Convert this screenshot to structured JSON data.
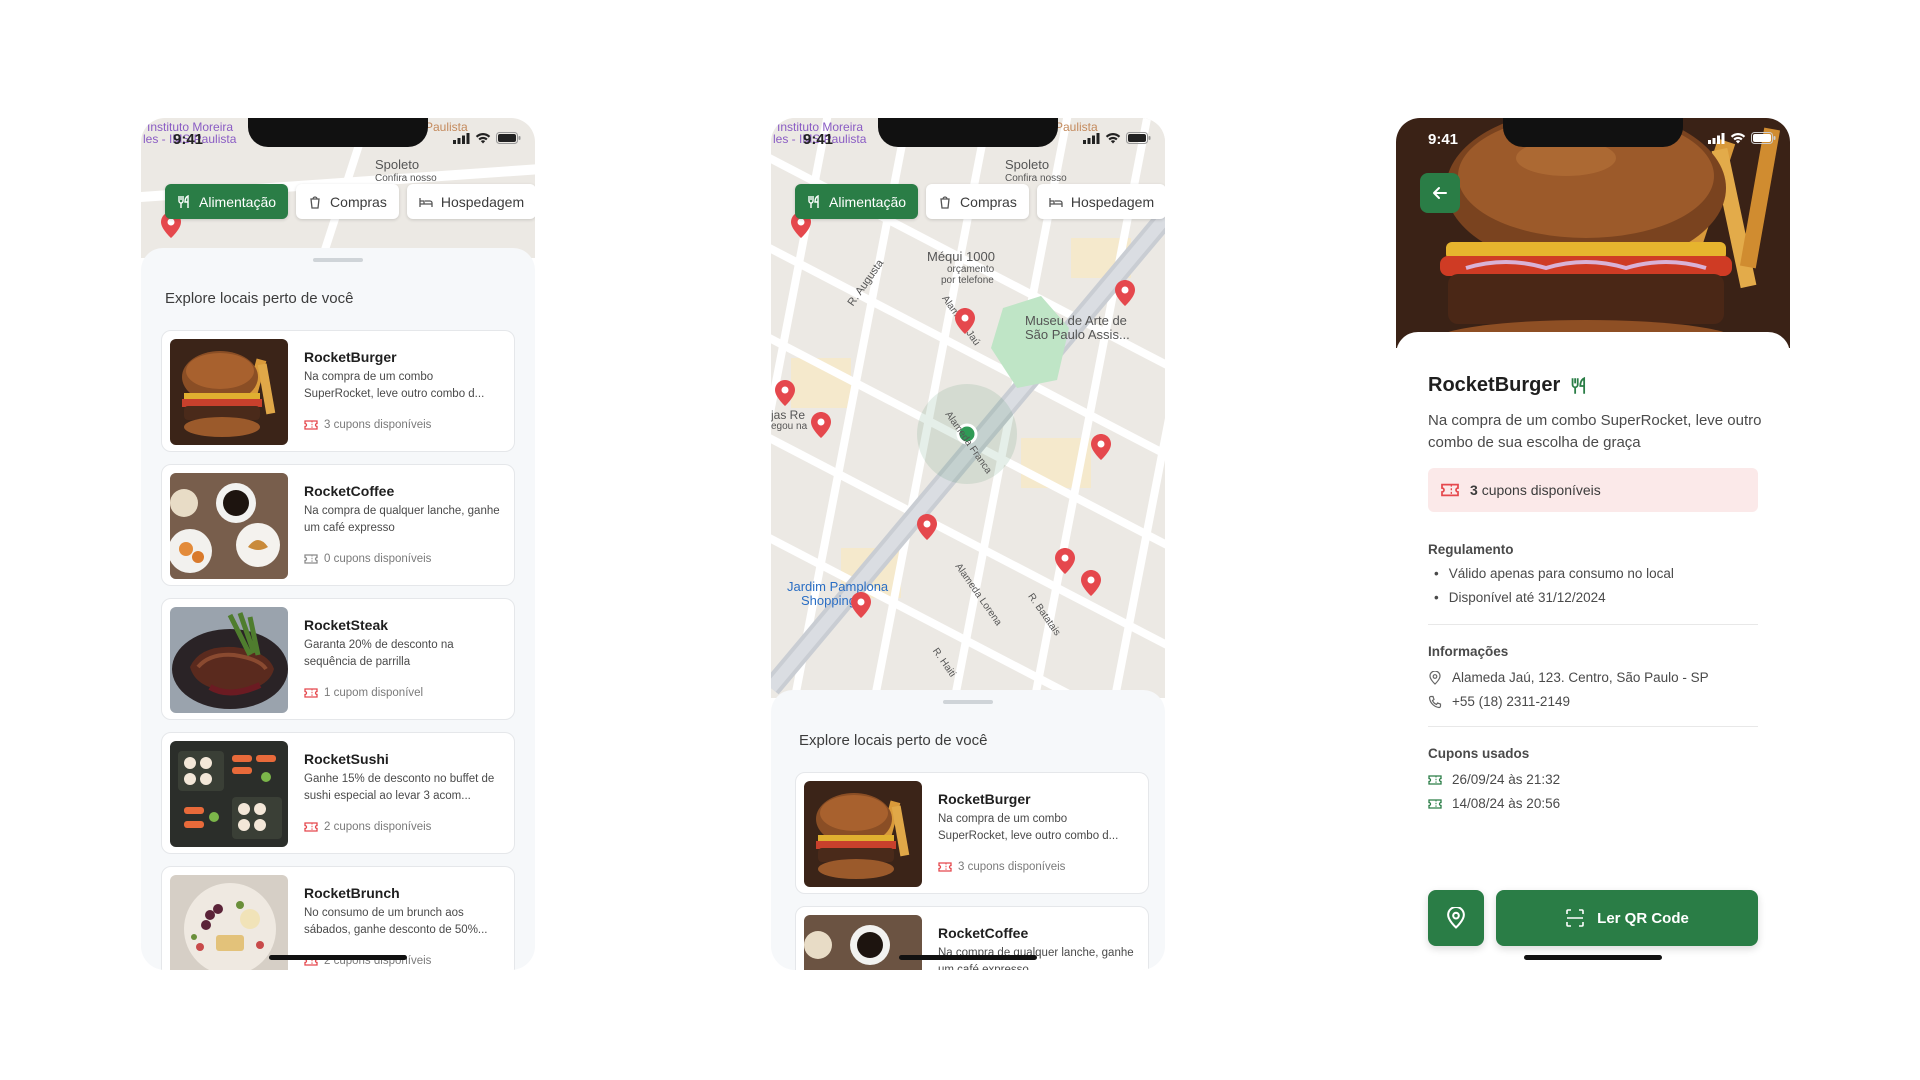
{
  "status": {
    "time": "9:41"
  },
  "chips": [
    "Alimentação",
    "Compras",
    "Hospedagem"
  ],
  "sheet_title": "Explore locais perto de você",
  "places": [
    {
      "name": "RocketBurger",
      "desc": "Na compra de um combo SuperRocket, leve outro combo d...",
      "coupons": "3 cupons disponíveis"
    },
    {
      "name": "RocketCoffee",
      "desc": "Na compra de qualquer lanche, ganhe um café expresso",
      "coupons": "0 cupons disponíveis"
    },
    {
      "name": "RocketSteak",
      "desc": "Garanta 20% de desconto na sequência de parrilla",
      "coupons": "1 cupom disponível"
    },
    {
      "name": "RocketSushi",
      "desc": "Ganhe 15% de desconto no buffet de sushi especial ao levar 3 acom...",
      "coupons": "2 cupons disponíveis"
    },
    {
      "name": "RocketBrunch",
      "desc": "No consumo de um brunch aos sábados, ganhe desconto de 50%...",
      "coupons": "2 cupons disponíveis"
    }
  ],
  "map_labels": {
    "top1": "Instituto Moreira",
    "top2": "les - IMS Paulista",
    "top3": "Paulista",
    "spoleto": "Spoleto",
    "spoleto_sub": "Confira nosso",
    "mequi": "Méqui 1000",
    "mequi_sub1": "orçamento",
    "mequi_sub2": "por telefone",
    "museu1": "Museu de Arte de",
    "museu2": "São Paulo Assis...",
    "augusta": "R. Augusta",
    "jau": "Alameda Jaú",
    "franca": "Alameda Franca",
    "lorena": "Alameda Lorena",
    "batatais": "R. Batatais",
    "haiti": "R. Haiti",
    "jardim1": "Jardim Pamplona",
    "jardim2": "Shopping",
    "left1": "jas Re",
    "left2": "egou na"
  },
  "detail": {
    "title": "RocketBurger",
    "desc": "Na compra de um combo SuperRocket, leve outro combo de sua escolha de graça",
    "coupon_count": "3",
    "coupon_text": "cupons disponíveis",
    "rules_title": "Regulamento",
    "rules": [
      "Válido apenas para consumo no local",
      "Disponível até 31/12/2024"
    ],
    "info_title": "Informações",
    "address": "Alameda Jaú, 123. Centro, São Paulo - SP",
    "phone": "+55 (18) 2311-2149",
    "used_title": "Cupons usados",
    "used": [
      "26/09/24 às 21:32",
      "14/08/24 às 20:56"
    ],
    "qr_label": "Ler QR Code"
  },
  "colors": {
    "brand_green": "#2a7d46",
    "coupon_red": "#e5484d",
    "coupon_bg": "#fbe9e9",
    "sheet_bg": "#f6f8fa"
  }
}
